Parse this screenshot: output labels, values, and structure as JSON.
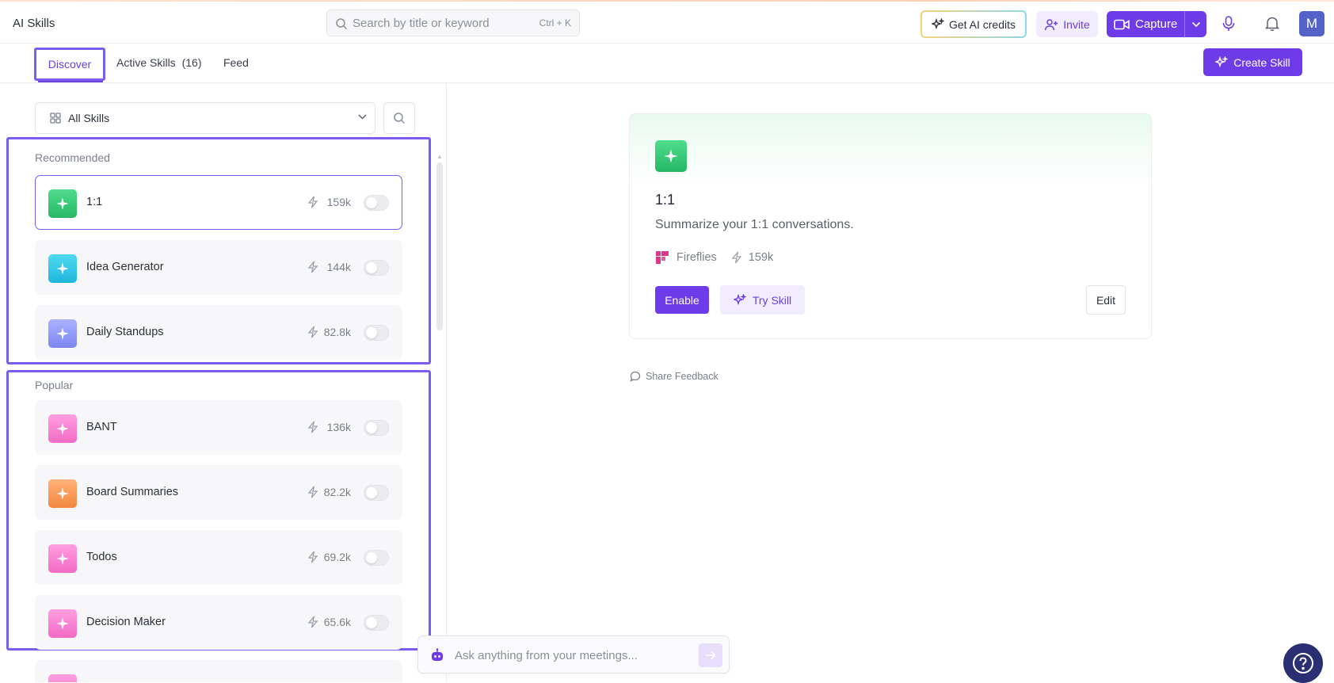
{
  "app": {
    "title": "AI Skills"
  },
  "search": {
    "placeholder": "Search by title or keyword",
    "shortcut": "Ctrl + K"
  },
  "header": {
    "credits_label": "Get AI credits",
    "invite_label": "Invite",
    "capture_label": "Capture",
    "avatar_initial": "M"
  },
  "tabs": [
    {
      "label": "Discover",
      "active": true
    },
    {
      "label": "Active Skills",
      "count": "(16)"
    },
    {
      "label": "Feed"
    }
  ],
  "create_skill_label": "Create Skill",
  "filter": {
    "selected": "All Skills"
  },
  "sections": {
    "recommended": {
      "label": "Recommended",
      "items": [
        {
          "name": "1:1",
          "count": "159k",
          "color_top": "#4fdc8e",
          "color_bottom": "#27b865",
          "icon": "sparkle-icon",
          "selected": true,
          "enabled": false
        },
        {
          "name": "Idea Generator",
          "count": "144k",
          "color_top": "#4fd9f0",
          "color_bottom": "#1fb7dd",
          "icon": "sparkle-icon",
          "enabled": false
        },
        {
          "name": "Daily Standups",
          "count": "82.8k",
          "color_top": "#a9b2ff",
          "color_bottom": "#7c86f2",
          "icon": "sparkle-icon",
          "enabled": false
        }
      ]
    },
    "popular": {
      "label": "Popular",
      "items": [
        {
          "name": "BANT",
          "count": "136k",
          "color_top": "#ff9ee0",
          "color_bottom": "#f26bc5",
          "icon": "sparkle-icon",
          "enabled": false
        },
        {
          "name": "Board Summaries",
          "count": "82.2k",
          "color_top": "#ffb27a",
          "color_bottom": "#f3873f",
          "icon": "sparkle-icon",
          "enabled": false
        },
        {
          "name": "Todos",
          "count": "69.2k",
          "color_top": "#ff9ee0",
          "color_bottom": "#f26bc5",
          "icon": "sparkle-icon",
          "enabled": false
        },
        {
          "name": "Decision Maker",
          "count": "65.6k",
          "color_top": "#ff9ee0",
          "color_bottom": "#f26bc5",
          "icon": "sparkle-icon",
          "enabled": false
        }
      ]
    }
  },
  "detail": {
    "title": "1:1",
    "description": "Summarize your 1:1 conversations.",
    "author": "Fireflies",
    "count": "159k",
    "enable_label": "Enable",
    "try_label": "Try Skill",
    "edit_label": "Edit"
  },
  "share_feedback_label": "Share Feedback",
  "ask": {
    "placeholder": "Ask anything from your meetings..."
  },
  "colors": {
    "accent": "#6f3ae8",
    "highlight": "#7b5cf0",
    "fireflies": "#e0338a"
  }
}
